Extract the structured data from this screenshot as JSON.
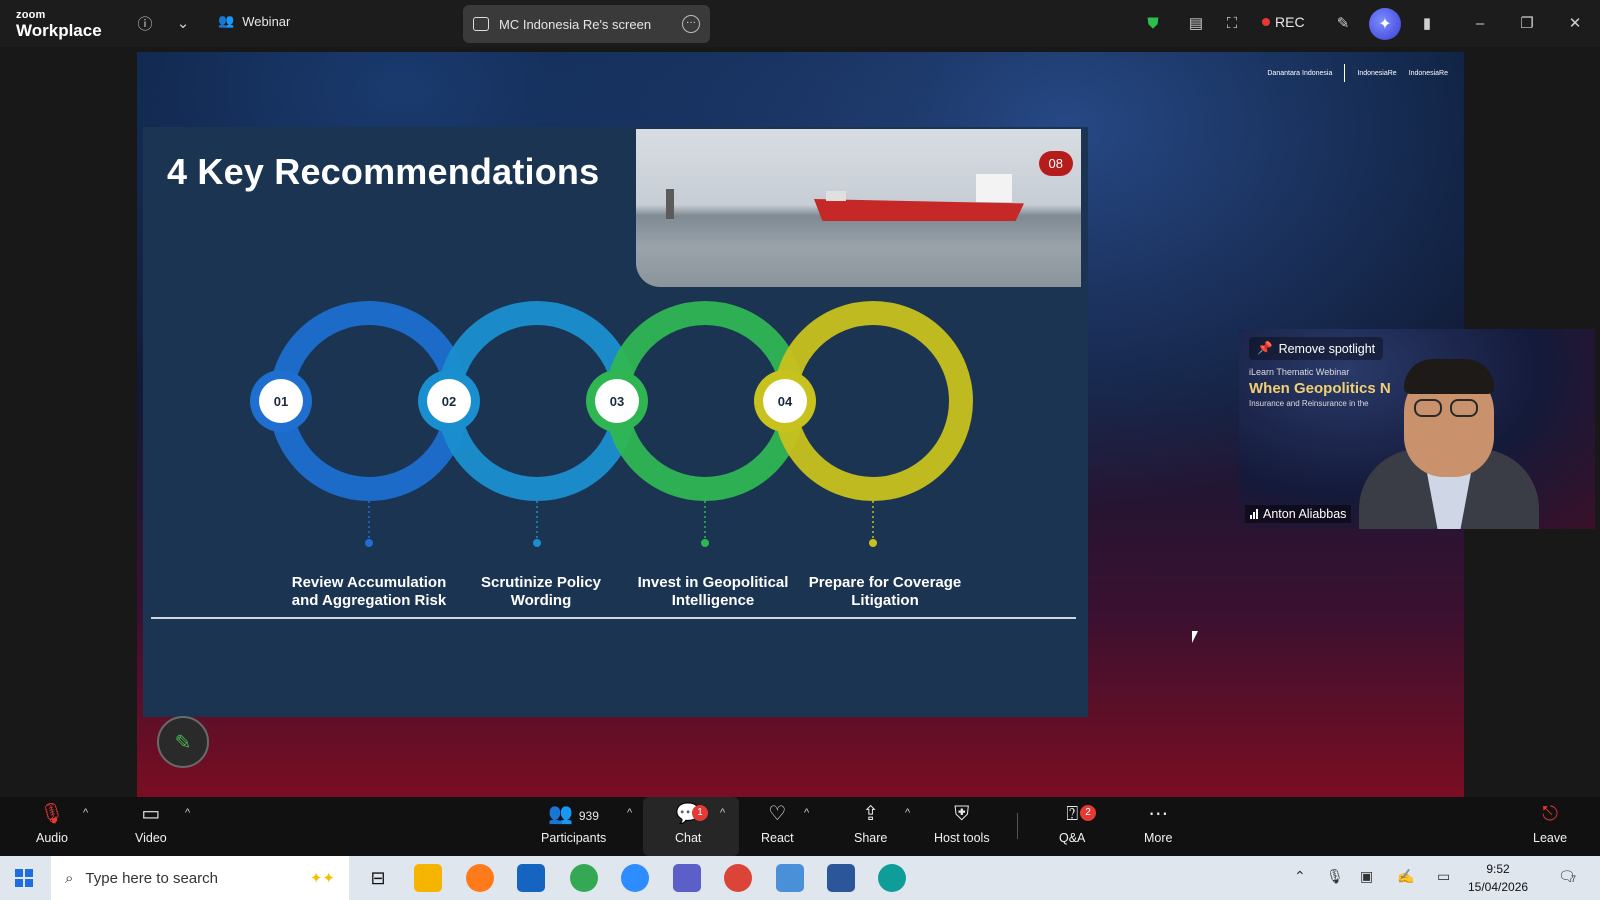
{
  "titlebar": {
    "brand_top": "zoom",
    "brand_bottom": "Workplace",
    "webinar_label": "Webinar",
    "share_tab_label": "MC Indonesia Re's screen",
    "rec_label": "REC"
  },
  "stage": {
    "logos": [
      "Danantara Indonesia",
      "IndonesiaRe",
      "IndonesiaRe"
    ]
  },
  "slide": {
    "title": "4 Key Recommendations",
    "page_number": "08",
    "steps": [
      {
        "number": "01",
        "label_line1": "Review Accumulation",
        "label_line2": "and Aggregation Risk",
        "color": "#1e6fd0"
      },
      {
        "number": "02",
        "label_line1": "Scrutinize Policy",
        "label_line2": "Wording",
        "color": "#1a8fd0"
      },
      {
        "number": "03",
        "label_line1": "Invest in Geopolitical",
        "label_line2": "Intelligence",
        "color": "#2fb653"
      },
      {
        "number": "04",
        "label_line1": "Prepare for Coverage",
        "label_line2": "Litigation",
        "color": "#c8c21e"
      }
    ]
  },
  "spotlight": {
    "remove_label": "Remove spotlight",
    "overlay_line1": "iLearn Thematic Webinar",
    "overlay_line2": "When Geopolitics N",
    "overlay_line3": "Insurance and Reinsurance in the",
    "participant_name": "Anton Aliabbas"
  },
  "toolbar": {
    "audio": "Audio",
    "video": "Video",
    "participants": "Participants",
    "participants_count": "939",
    "chat": "Chat",
    "chat_badge": "1",
    "react": "React",
    "share": "Share",
    "host_tools": "Host tools",
    "qa": "Q&A",
    "qa_badge": "2",
    "more": "More",
    "leave": "Leave"
  },
  "taskbar": {
    "search_placeholder": "Type here to search",
    "time": "9:52",
    "date": "15/04/2026",
    "notifications": "7"
  }
}
